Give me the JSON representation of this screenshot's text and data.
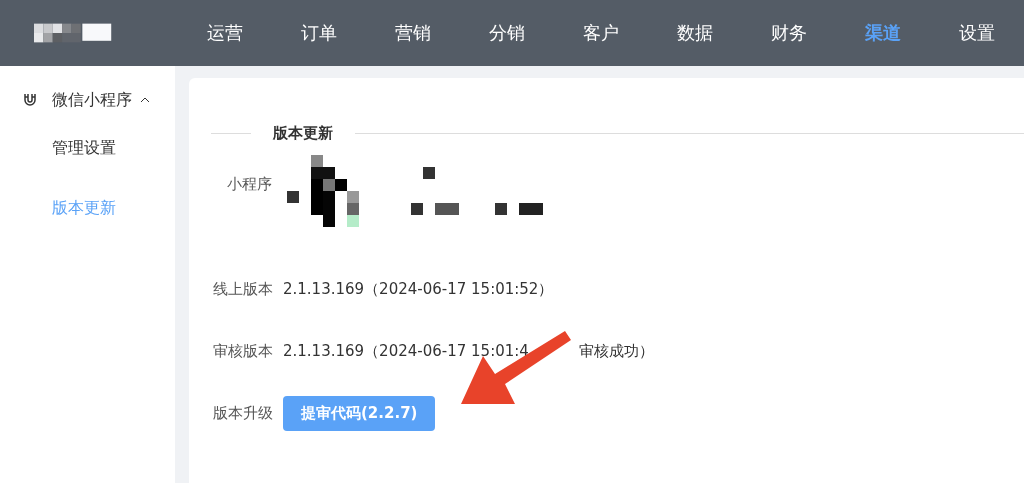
{
  "header": {
    "nav": [
      {
        "label": "运营",
        "selected": false
      },
      {
        "label": "订单",
        "selected": false
      },
      {
        "label": "营销",
        "selected": false
      },
      {
        "label": "分销",
        "selected": false
      },
      {
        "label": "客户",
        "selected": false
      },
      {
        "label": "数据",
        "selected": false
      },
      {
        "label": "财务",
        "selected": false
      },
      {
        "label": "渠道",
        "selected": true
      },
      {
        "label": "设置",
        "selected": false
      }
    ]
  },
  "sidebar": {
    "group": {
      "label": "微信小程序",
      "expanded": true,
      "items": [
        {
          "label": "管理设置",
          "selected": false
        },
        {
          "label": "版本更新",
          "selected": true
        }
      ]
    }
  },
  "content": {
    "section_title": "版本更新",
    "mini_program": {
      "label": "小程序"
    },
    "fields": [
      {
        "label": "线上版本",
        "value": "2.1.13.169（2024-06-17 15:01:52）"
      },
      {
        "label": "审核版本",
        "value": "2.1.13.169（2024-06-17 15:01:4",
        "value_tail": "审核成功）"
      }
    ],
    "upgrade": {
      "label": "版本升级",
      "button": "提审代码(2.2.7)"
    }
  }
}
